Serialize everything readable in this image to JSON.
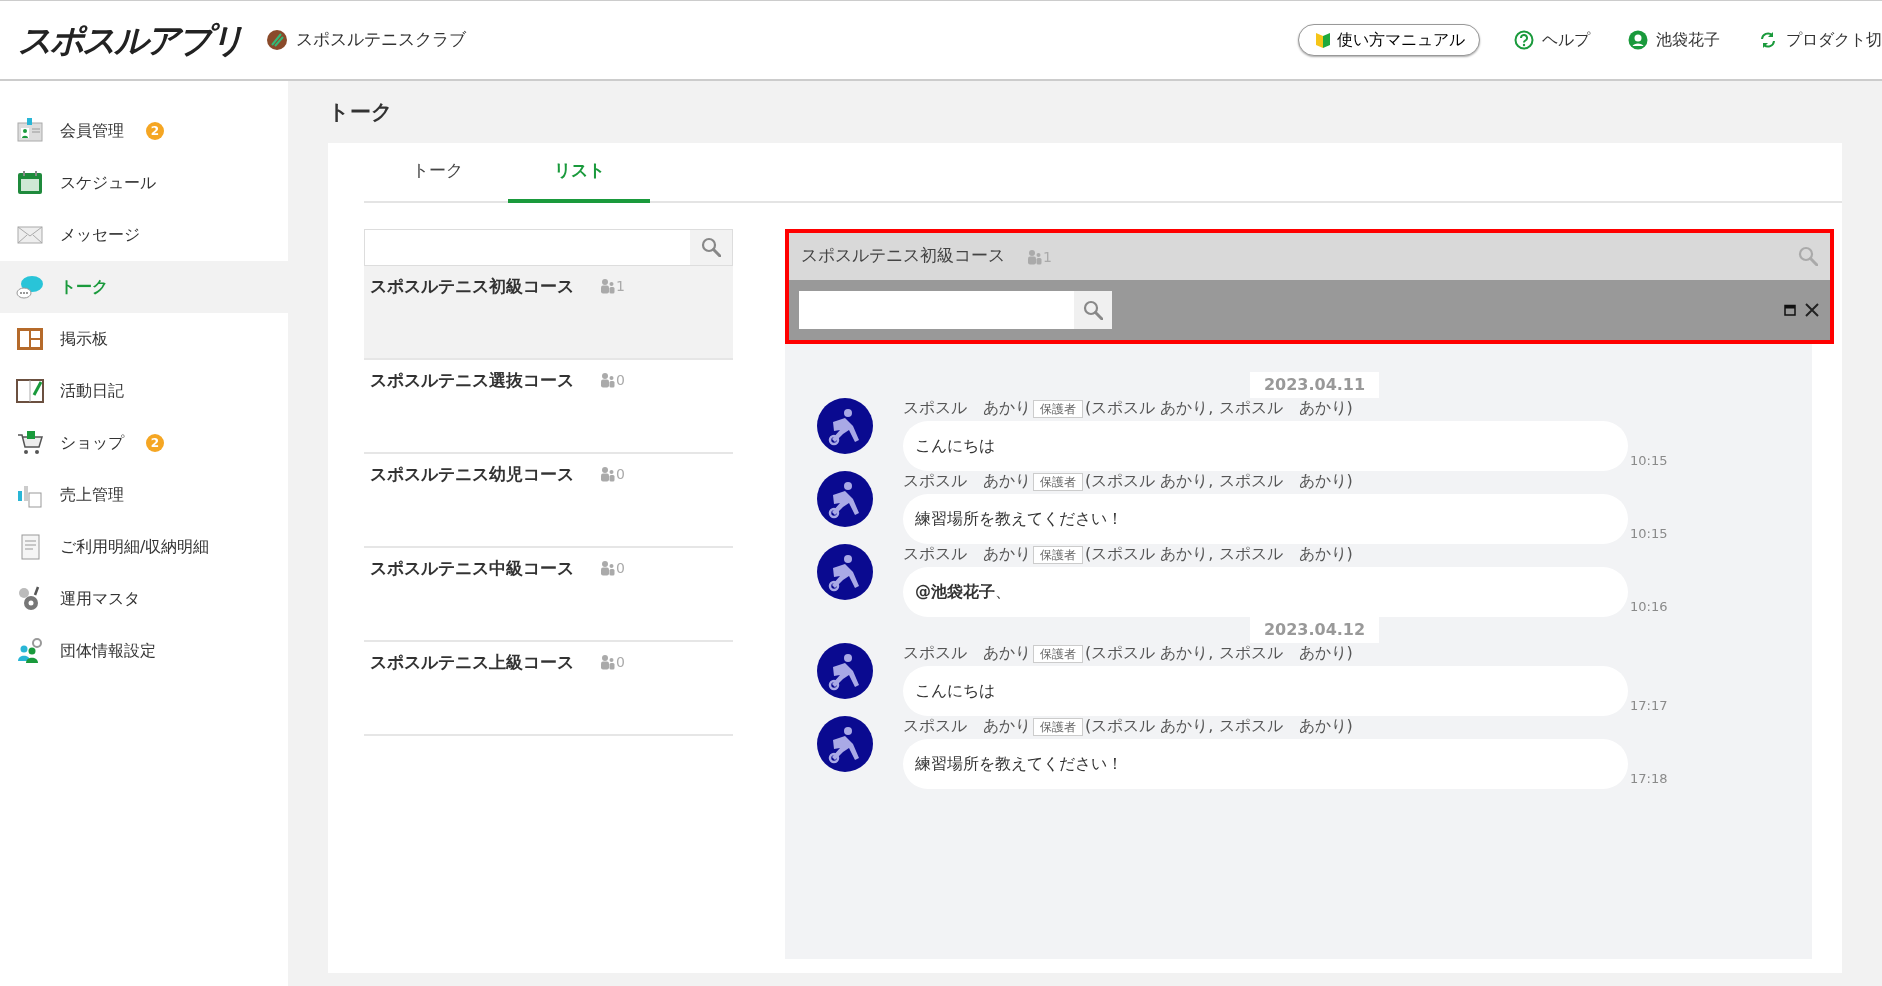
{
  "header": {
    "logo": "スポスルアプリ",
    "club_name": "スポスルテニスクラブ",
    "actions": [
      {
        "kind": "manual",
        "label": "使い方マニュアル"
      },
      {
        "kind": "help",
        "label": "ヘルプ"
      },
      {
        "kind": "user",
        "label": "池袋花子"
      },
      {
        "kind": "switch",
        "label": "プロダクト切"
      }
    ]
  },
  "sidebar": {
    "items": [
      {
        "label": "会員管理",
        "badge": "2",
        "selected": false
      },
      {
        "label": "スケジュール",
        "selected": false
      },
      {
        "label": "メッセージ",
        "selected": false
      },
      {
        "label": "トーク",
        "selected": true
      },
      {
        "label": "掲示板",
        "selected": false
      },
      {
        "label": "活動日記",
        "selected": false
      },
      {
        "label": "ショップ",
        "badge": "2",
        "selected": false
      },
      {
        "label": "売上管理",
        "selected": false
      },
      {
        "label": "ご利用明細/収納明細",
        "selected": false
      },
      {
        "label": "運用マスタ",
        "selected": false
      },
      {
        "label": "団体情報設定",
        "selected": false
      }
    ]
  },
  "page_title": "トーク",
  "tabs": [
    {
      "label": "トーク",
      "selected": false
    },
    {
      "label": "リスト",
      "selected": true
    }
  ],
  "list": {
    "items": [
      {
        "name": "スポスルテニス初級コース",
        "count": "1",
        "selected": true
      },
      {
        "name": "スポスルテニス選抜コース",
        "count": "0",
        "selected": false
      },
      {
        "name": "スポスルテニス幼児コース",
        "count": "0",
        "selected": false
      },
      {
        "name": "スポスルテニス中級コース",
        "count": "0",
        "selected": false
      },
      {
        "name": "スポスルテニス上級コース",
        "count": "0",
        "selected": false
      }
    ]
  },
  "chat": {
    "title": "スポスルテニス初級コース",
    "count": "1",
    "highlighted": true,
    "messages": [
      {
        "kind": "date",
        "text": "2023.04.11"
      },
      {
        "kind": "message",
        "sender": "スポスル　あかり",
        "role": "保護者",
        "detail": "(スポスル あかり, スポスル　あかり)",
        "text": "こんにちは",
        "time": "10:15"
      },
      {
        "kind": "message",
        "sender": "スポスル　あかり",
        "role": "保護者",
        "detail": "(スポスル あかり, スポスル　あかり)",
        "text": "練習場所を教えてください！",
        "time": "10:15"
      },
      {
        "kind": "message",
        "sender": "スポスル　あかり",
        "role": "保護者",
        "detail": "(スポスル あかり, スポスル　あかり)",
        "text": "**@池袋花子**、",
        "time": "10:16"
      },
      {
        "kind": "date",
        "text": "2023.04.12"
      },
      {
        "kind": "message",
        "sender": "スポスル　あかり",
        "role": "保護者",
        "detail": "(スポスル あかり, スポスル　あかり)",
        "text": "こんにちは",
        "time": "17:17"
      },
      {
        "kind": "message",
        "sender": "スポスル　あかり",
        "role": "保護者",
        "detail": "(スポスル あかり, スポスル　あかり)",
        "text": "練習場所を教えてください！",
        "time": "17:18"
      }
    ]
  }
}
